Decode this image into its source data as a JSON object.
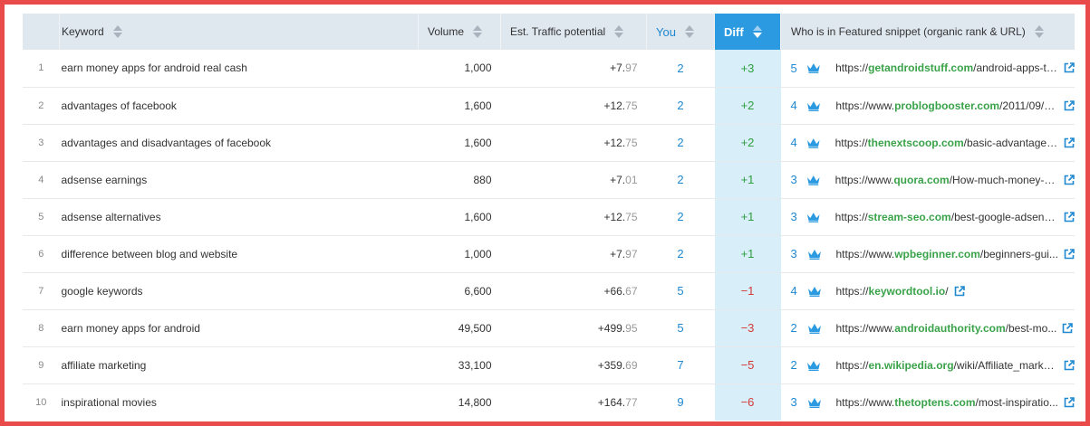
{
  "columns": {
    "keyword": "Keyword",
    "volume": "Volume",
    "traffic": "Est. Traffic potential",
    "you": "You",
    "diff": "Diff",
    "snippet": "Who is in Featured snippet (organic rank & URL)"
  },
  "colors": {
    "accent": "#2b9ae0",
    "positive": "#2e9e3f",
    "negative": "#d23a3a",
    "domain": "#3aa34a",
    "frame": "#e94a4a"
  },
  "rows": [
    {
      "num": "1",
      "keyword": "earn money apps for android real cash",
      "volume": "1,000",
      "traffic_int": "+7.",
      "traffic_dec": "97",
      "you": "2",
      "diff": "+3",
      "diff_sign": "pos",
      "rank": "5",
      "url_pre": "https://",
      "url_domain": "getandroidstuff.com",
      "url_post": "/android-apps-to..."
    },
    {
      "num": "2",
      "keyword": "advantages of facebook",
      "volume": "1,600",
      "traffic_int": "+12.",
      "traffic_dec": "75",
      "you": "2",
      "diff": "+2",
      "diff_sign": "pos",
      "rank": "4",
      "url_pre": "https://www.",
      "url_domain": "problogbooster.com",
      "url_post": "/2011/09/a..."
    },
    {
      "num": "3",
      "keyword": "advantages and disadvantages of facebook",
      "volume": "1,600",
      "traffic_int": "+12.",
      "traffic_dec": "75",
      "you": "2",
      "diff": "+2",
      "diff_sign": "pos",
      "rank": "4",
      "url_pre": "https://",
      "url_domain": "thenextscoop.com",
      "url_post": "/basic-advantage-d..."
    },
    {
      "num": "4",
      "keyword": "adsense earnings",
      "volume": "880",
      "traffic_int": "+7.",
      "traffic_dec": "01",
      "you": "2",
      "diff": "+1",
      "diff_sign": "pos",
      "rank": "3",
      "url_pre": "https://www.",
      "url_domain": "quora.com",
      "url_post": "/How-much-money-ca..."
    },
    {
      "num": "5",
      "keyword": "adsense alternatives",
      "volume": "1,600",
      "traffic_int": "+12.",
      "traffic_dec": "75",
      "you": "2",
      "diff": "+1",
      "diff_sign": "pos",
      "rank": "3",
      "url_pre": "https://",
      "url_domain": "stream-seo.com",
      "url_post": "/best-google-adsense..."
    },
    {
      "num": "6",
      "keyword": "difference between blog and website",
      "volume": "1,000",
      "traffic_int": "+7.",
      "traffic_dec": "97",
      "you": "2",
      "diff": "+1",
      "diff_sign": "pos",
      "rank": "3",
      "url_pre": "https://www.",
      "url_domain": "wpbeginner.com",
      "url_post": "/beginners-gui..."
    },
    {
      "num": "7",
      "keyword": "google keywords",
      "volume": "6,600",
      "traffic_int": "+66.",
      "traffic_dec": "67",
      "you": "5",
      "diff": "−1",
      "diff_sign": "neg",
      "rank": "4",
      "url_pre": "https://",
      "url_domain": "keywordtool.io",
      "url_post": "/"
    },
    {
      "num": "8",
      "keyword": "earn money apps for android",
      "volume": "49,500",
      "traffic_int": "+499.",
      "traffic_dec": "95",
      "you": "5",
      "diff": "−3",
      "diff_sign": "neg",
      "rank": "2",
      "url_pre": "https://www.",
      "url_domain": "androidauthority.com",
      "url_post": "/best-mo..."
    },
    {
      "num": "9",
      "keyword": "affiliate marketing",
      "volume": "33,100",
      "traffic_int": "+359.",
      "traffic_dec": "69",
      "you": "7",
      "diff": "−5",
      "diff_sign": "neg",
      "rank": "2",
      "url_pre": "https://",
      "url_domain": "en.wikipedia.org",
      "url_post": "/wiki/Affiliate_marke..."
    },
    {
      "num": "10",
      "keyword": "inspirational movies",
      "volume": "14,800",
      "traffic_int": "+164.",
      "traffic_dec": "77",
      "you": "9",
      "diff": "−6",
      "diff_sign": "neg",
      "rank": "3",
      "url_pre": "https://www.",
      "url_domain": "thetoptens.com",
      "url_post": "/most-inspiratio..."
    }
  ]
}
